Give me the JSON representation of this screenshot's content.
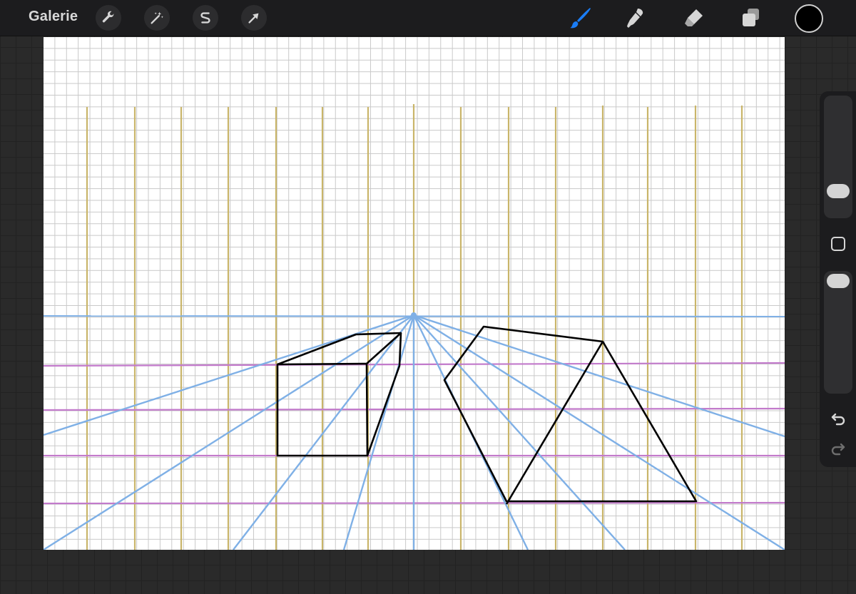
{
  "toolbar": {
    "gallery_label": "Galerie",
    "left_tools": [
      {
        "name": "actions-wrench-icon"
      },
      {
        "name": "adjustments-magic-wand-icon"
      },
      {
        "name": "selection-s-icon"
      },
      {
        "name": "transform-arrow-icon"
      }
    ],
    "right_tools": [
      {
        "name": "brush-icon",
        "active": true
      },
      {
        "name": "smudge-icon"
      },
      {
        "name": "eraser-icon"
      },
      {
        "name": "layers-icon"
      }
    ],
    "current_color": "#000000",
    "active_color": "#1a7df7",
    "icon_color": "#d6d6d6"
  },
  "canvas": {
    "guide": "perspective-one-point",
    "horizon_color": "#7fb0e6",
    "vertical_guide_color": "#c9b56a",
    "horizontal_guide_color": "#c27acb",
    "vanishing_point_color": "#7fb0e6"
  },
  "sidebar": {
    "brush_size_level": 0.55,
    "opacity_level": 0.05,
    "tools": [
      "modify-square-icon",
      "undo-icon",
      "redo-icon"
    ]
  }
}
